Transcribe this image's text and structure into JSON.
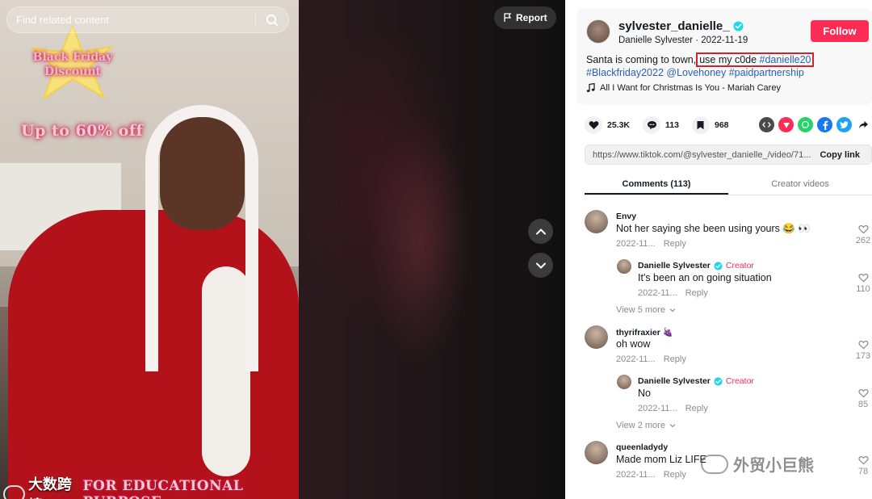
{
  "search": {
    "placeholder": "Find related content"
  },
  "promo": {
    "star_line1": "Black Friday",
    "star_line2": "Discount",
    "off_text": "Up to 60% off"
  },
  "video_caption": {
    "watermark": "大数跨境",
    "text": "FOR EDUCATIONAL PURPOSE"
  },
  "report": {
    "label": "Report"
  },
  "author": {
    "username": "sylvester_danielle_",
    "display_name": "Danielle Sylvester",
    "date": "2022-11-19",
    "follow_label": "Follow"
  },
  "description": {
    "text_before": "Santa is coming to town,",
    "highlight_plain": "use my c0de ",
    "highlight_tag": "#danielle20",
    "tags": [
      "#Blackfriday2022",
      "@Lovehoney",
      "#paidpartnership"
    ]
  },
  "music": {
    "title": "All I Want for Christmas Is You - Mariah Carey"
  },
  "stats": {
    "likes": "25.3K",
    "comments": "113",
    "saves": "968"
  },
  "share_colors": {
    "embed": "#4a4a4a",
    "friends": "#fe2c55",
    "whatsapp": "#25d366",
    "facebook": "#1877f2",
    "twitter": "#1da1f2"
  },
  "link": {
    "url": "https://www.tiktok.com/@sylvester_danielle_/video/71...",
    "copy_label": "Copy link"
  },
  "tabs": [
    {
      "label": "Comments (113)"
    },
    {
      "label": "Creator videos"
    }
  ],
  "comments": [
    {
      "name": "Envy",
      "text": "Not her saying she been using yours 😂 👀",
      "date": "2022-11...",
      "reply": "Reply",
      "likes": "262",
      "replies": [
        {
          "name": "Danielle Sylvester",
          "badge": "Creator",
          "text": "It's been an on going situation",
          "date": "2022-11...",
          "reply": "Reply",
          "likes": "110"
        }
      ],
      "view_more": "View 5 more"
    },
    {
      "name": "thyrifraxier 🍇",
      "text": "oh wow",
      "date": "2022-11...",
      "reply": "Reply",
      "likes": "173",
      "replies": [
        {
          "name": "Danielle Sylvester",
          "badge": "Creator",
          "text": "No",
          "date": "2022-11...",
          "reply": "Reply",
          "likes": "85"
        }
      ],
      "view_more": "View 2 more"
    },
    {
      "name": "queenladydy",
      "text": "Made mom Liz LIFE",
      "date": "2022-11...",
      "reply": "Reply",
      "likes": "78"
    }
  ],
  "watermark_bottom": {
    "text": "外贸小巨熊"
  }
}
